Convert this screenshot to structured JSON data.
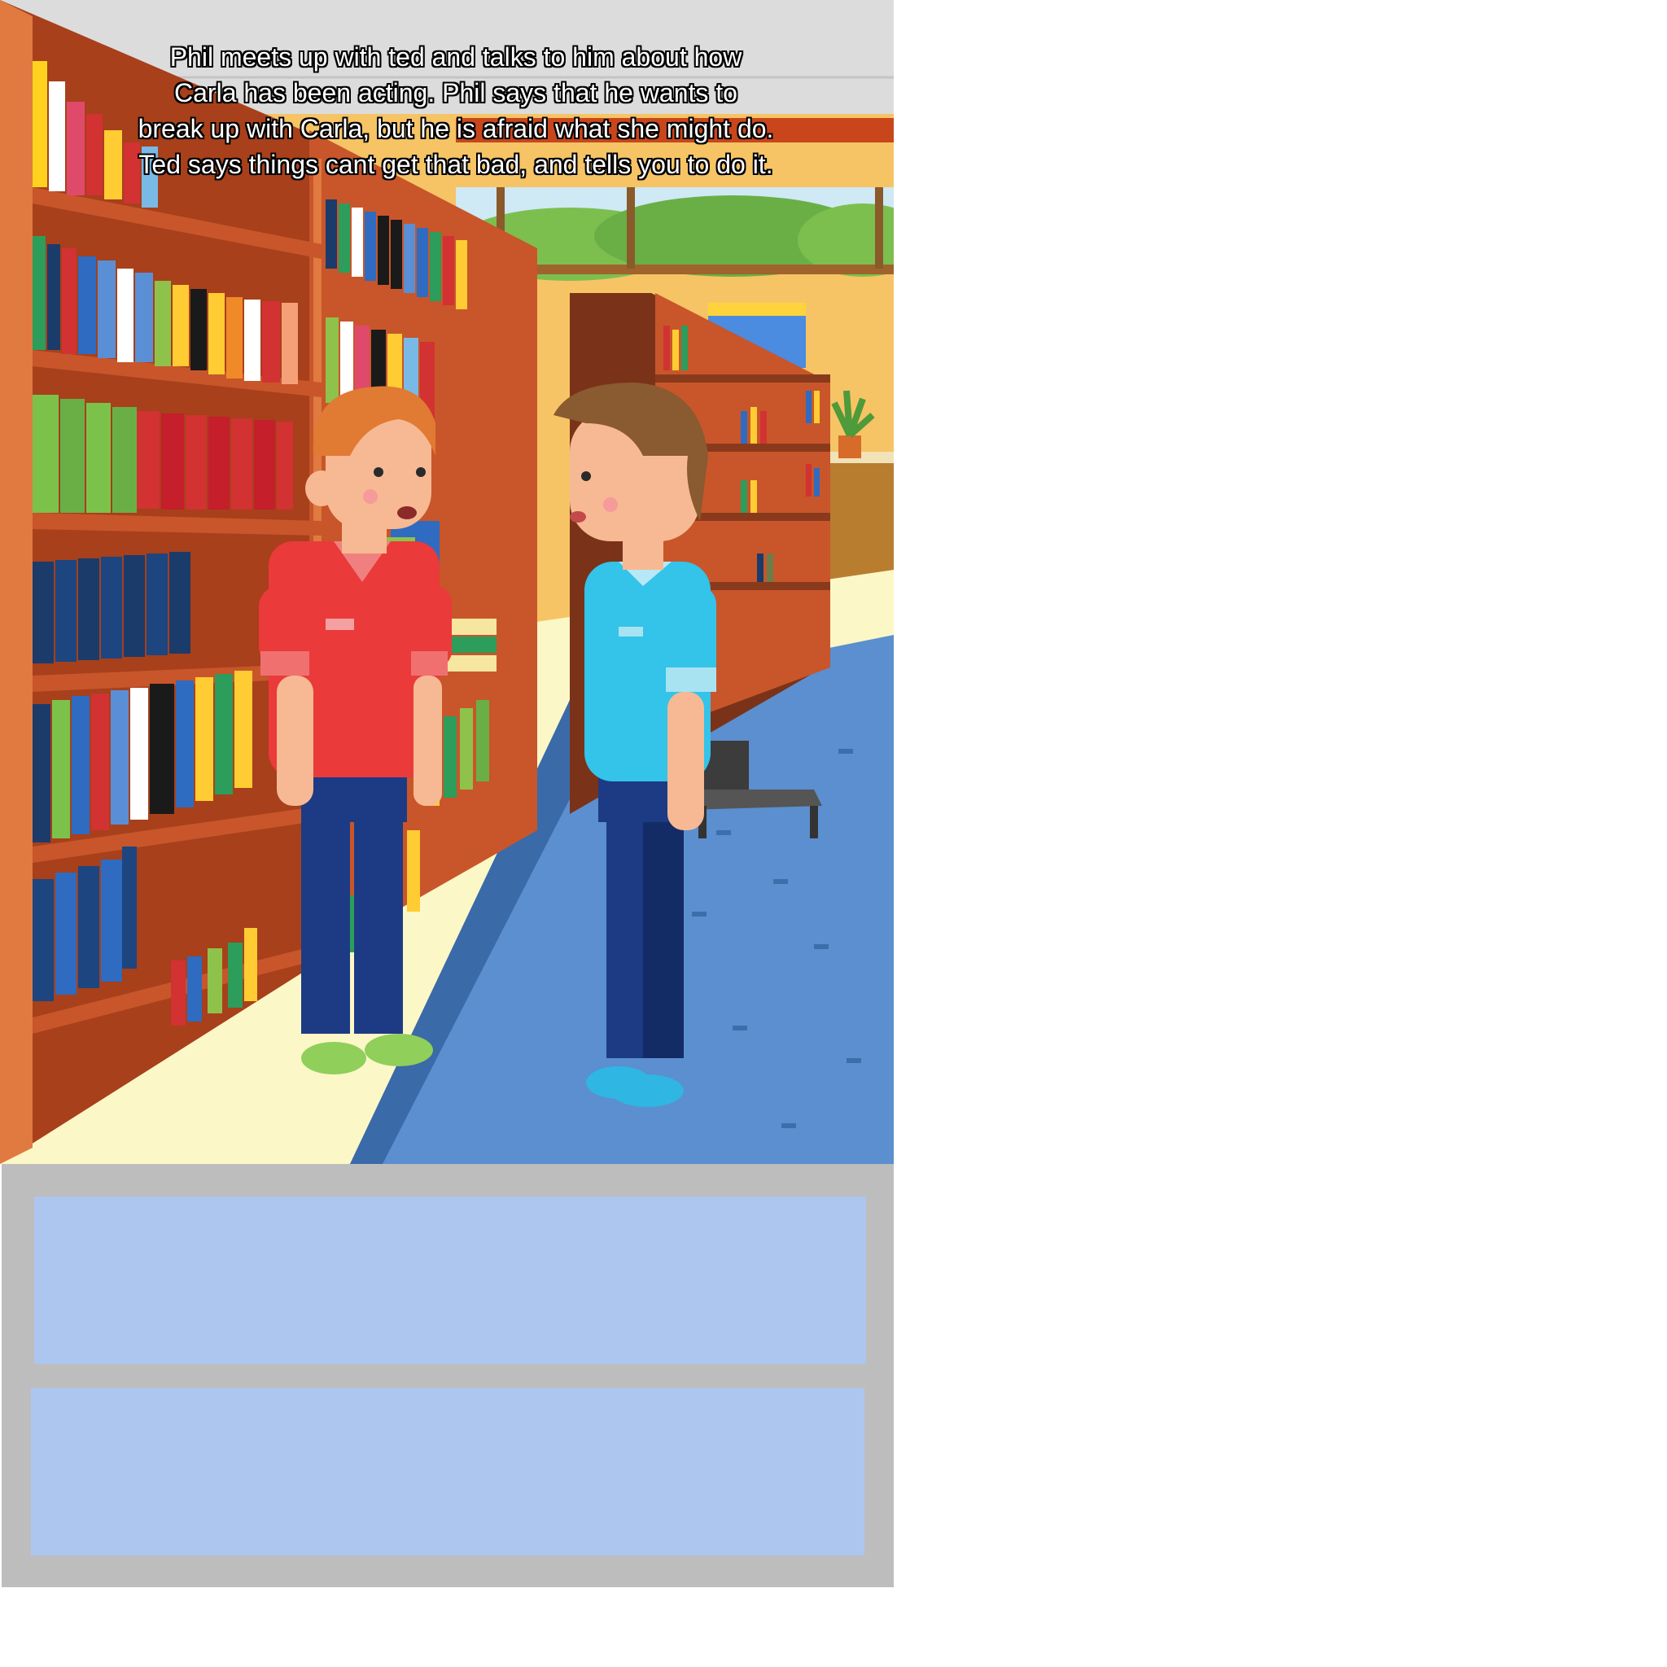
{
  "scene": {
    "narration": "Phil meets up with ted and talks to him about how\nCarla has been acting.  Phil says that he wants to\nbreak up with Carla, but he is afraid what she might do.\nTed says things cant get that bad, and tells you to do it.",
    "characters": [
      {
        "shirt_color": "#ea3a3a",
        "shoe_color": "#8fcf5a"
      },
      {
        "shirt_color": "#34c3e9",
        "shoe_color": "#2fb6e3"
      }
    ],
    "setting_colors": {
      "wall": "#f6c465",
      "shelf": "#c8562a",
      "carpet": "#5b8fcf",
      "floor": "#fbf7c7"
    }
  },
  "choices": [
    {
      "label": ""
    },
    {
      "label": ""
    }
  ]
}
